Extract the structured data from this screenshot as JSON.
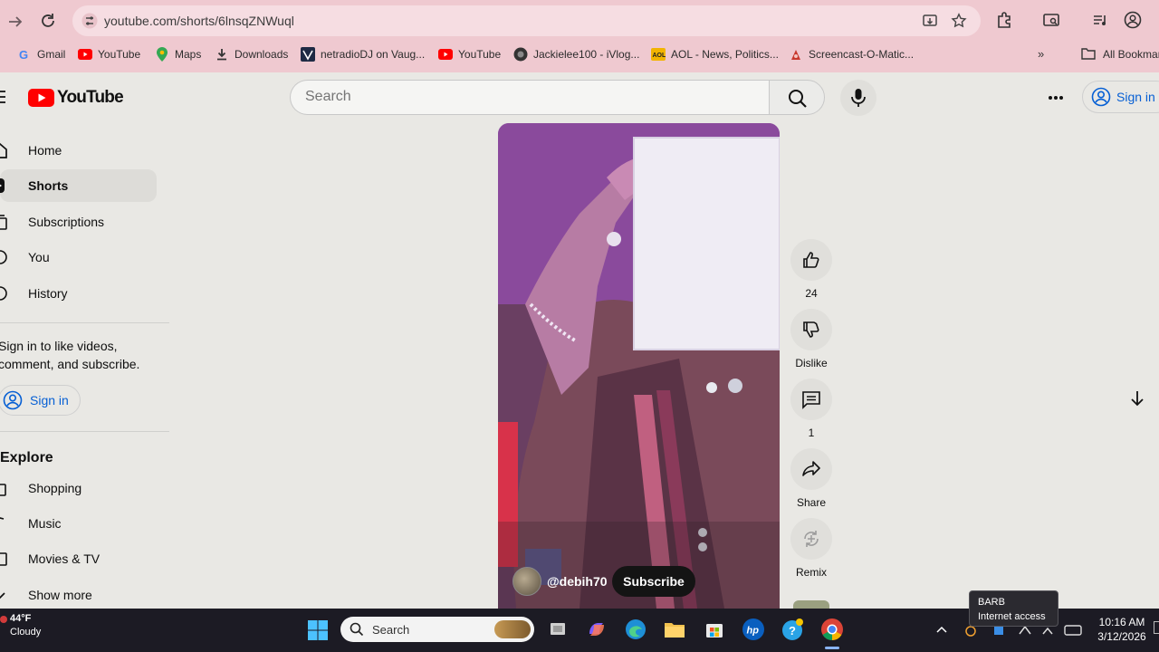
{
  "browser": {
    "url": "youtube.com/shorts/6lnsqZNWuql",
    "bookmarks": [
      {
        "label": "Gmail",
        "icon": "gmail-icon"
      },
      {
        "label": "YouTube",
        "icon": "youtube-icon"
      },
      {
        "label": "Maps",
        "icon": "maps-icon"
      },
      {
        "label": "Downloads",
        "icon": "download-icon"
      },
      {
        "label": "netradioDJ on Vaug...",
        "icon": "vaughn-icon"
      },
      {
        "label": "YouTube",
        "icon": "youtube-icon"
      },
      {
        "label": "Jackielee100 - iVlog...",
        "icon": "globe-icon"
      },
      {
        "label": "AOL - News, Politics...",
        "icon": "aol-icon"
      },
      {
        "label": "Screencast-O-Matic...",
        "icon": "screencast-icon"
      }
    ],
    "all_bookmarks": "All Bookmarks"
  },
  "header": {
    "logo_text": "YouTube",
    "search_placeholder": "Search",
    "sign_in": "Sign in"
  },
  "sidebar": {
    "items": [
      {
        "label": "Home",
        "icon": "home-icon"
      },
      {
        "label": "Shorts",
        "icon": "shorts-icon",
        "active": true
      },
      {
        "label": "Subscriptions",
        "icon": "subscriptions-icon"
      },
      {
        "label": "You",
        "icon": "you-icon"
      },
      {
        "label": "History",
        "icon": "history-icon"
      }
    ],
    "signin_prompt": "Sign in to like videos, comment, and subscribe.",
    "signin_button": "Sign in",
    "explore_heading": "Explore",
    "explore_items": [
      {
        "label": "Shopping",
        "icon": "shopping-icon"
      },
      {
        "label": "Music",
        "icon": "music-icon"
      },
      {
        "label": "Movies & TV",
        "icon": "movies-icon"
      },
      {
        "label": "Show more",
        "icon": "chevron-down-icon"
      }
    ]
  },
  "short": {
    "channel_handle": "@debih70",
    "subscribe_label": "Subscribe",
    "like_count": "24",
    "dislike_label": "Dislike",
    "comment_count": "1",
    "share_label": "Share",
    "remix_label": "Remix"
  },
  "taskbar": {
    "weather_temp": "44°F",
    "weather_desc": "Cloudy",
    "search_label": "Search",
    "time": "10:16 AM",
    "date": "3/12/2026",
    "tooltip_title": "BARB",
    "tooltip_status": "Internet access"
  },
  "colors": {
    "chrome_bg": "#efc9d0",
    "yt_red": "#ff0000",
    "link_blue": "#065fd4",
    "taskbar_bg": "#1c1b24"
  }
}
